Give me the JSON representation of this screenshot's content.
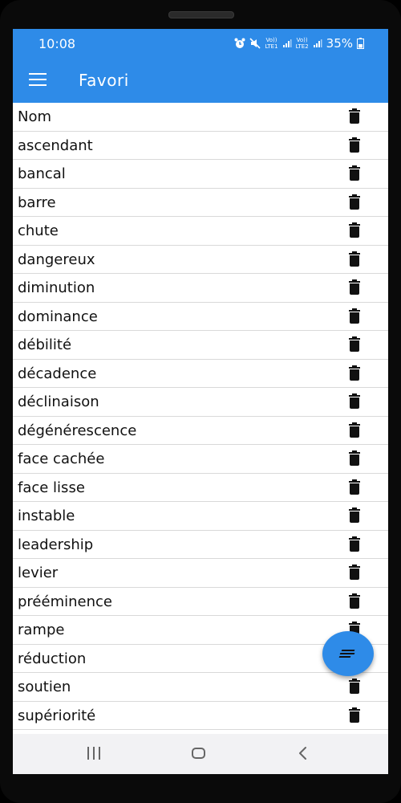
{
  "status_bar": {
    "time": "10:08",
    "sim1_label_top": "Vo))",
    "sim1_label_bottom": "LTE1",
    "sim2_label_top": "Vo))",
    "sim2_label_bottom": "LTE2",
    "battery": "35%",
    "icons": [
      "alarm-icon",
      "mute-icon",
      "signal-icon",
      "battery-icon"
    ]
  },
  "app_bar": {
    "title": "Favori",
    "menu_icon": "hamburger-menu-icon"
  },
  "list": {
    "items": [
      "Nom",
      "ascendant",
      "bancal",
      "barre",
      "chute",
      "dangereux",
      "diminution",
      "dominance",
      "débilité",
      "décadence",
      "déclinaison",
      "dégénérescence",
      "face cachée",
      "face lisse",
      "instable",
      "leadership",
      "levier",
      "prééminence",
      "rampe",
      "réduction",
      "soutien",
      "supériorité"
    ],
    "row_action_icon": "trash-icon"
  },
  "fab": {
    "icon": "sort-lines-icon"
  },
  "nav_bar": {
    "icons": [
      "recents-icon",
      "home-icon",
      "back-icon"
    ]
  },
  "colors": {
    "primary": "#2e8be8",
    "background": "#ffffff",
    "text": "#111111",
    "divider": "#d9d9d9",
    "navbar": "#f2f2f4"
  }
}
